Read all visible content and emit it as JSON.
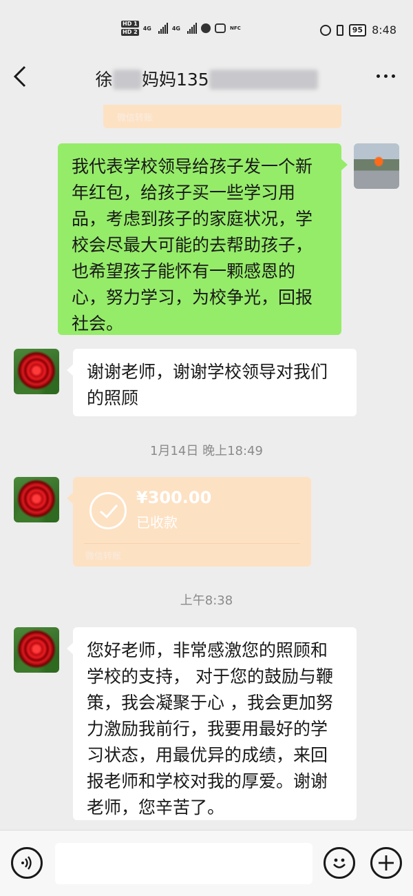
{
  "status_bar": {
    "hd1": "HD 1",
    "hd2": "HD 2",
    "net1": "4G",
    "net2": "4G",
    "battery": "95",
    "time": "8:48"
  },
  "header": {
    "title_prefix": "徐",
    "title_blur1": "██",
    "title_mid": "妈妈135",
    "title_blur2": "████████"
  },
  "messages": {
    "transfer_top_label": "微信转账",
    "self_message": "我代表学校领导给孩子发一个新年红包，给孩子买一些学习用品，考虑到孩子的家庭状况，学校会尽最大可能的去帮助孩子，也希望孩子能怀有一颗感恩的心，努力学习，为校争光，回报社会。",
    "reply1": "谢谢老师，谢谢学校领导对我们的照顾",
    "time1": "1月14日 晚上18:49",
    "transfer_amount": "¥300.00",
    "transfer_status": "已收款",
    "transfer_foot": "微信转账",
    "time2": "上午8:38",
    "reply2": "您好老师，非常感激您的照顾和学校的支持， 对于您的鼓励与鞭策，我会凝聚于心 ，我会更加努力激励我前行，我要用最好的学习状态，用最优异的成绩，来回报老师和学校对我的厚爱。谢谢老师，您辛苦了。"
  },
  "input_bar": {
    "placeholder": ""
  },
  "icons": {
    "back": "chevron-left-icon",
    "more": "more-dots-icon",
    "voice": "voice-icon",
    "emoji": "emoji-icon",
    "plus": "plus-icon",
    "check": "check-circle-icon"
  },
  "colors": {
    "self_bubble": "#95ec69",
    "other_bubble": "#ffffff",
    "transfer_card": "#fde1c3",
    "background": "#ededed"
  }
}
